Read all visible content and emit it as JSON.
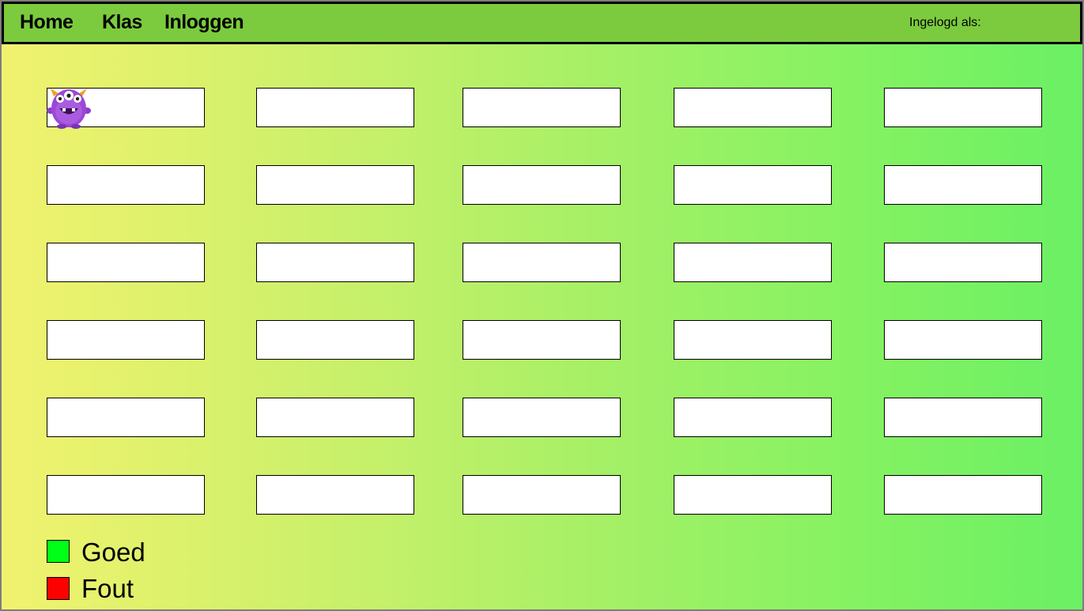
{
  "nav": {
    "items": [
      {
        "label": "Home"
      },
      {
        "label": "Klas"
      },
      {
        "label": "Inloggen"
      }
    ],
    "logged_in_label": "Ingelogd als:"
  },
  "board": {
    "columns": 5,
    "rows": 6,
    "avatar": "purple-monster-icon"
  },
  "legend": [
    {
      "label": "Goed",
      "color": "#00ff18"
    },
    {
      "label": "Fout",
      "color": "#ff0000"
    }
  ],
  "colors": {
    "navbar": "#7ccb3e",
    "gradient_start": "#f1f26e",
    "gradient_end": "#6bf064"
  }
}
